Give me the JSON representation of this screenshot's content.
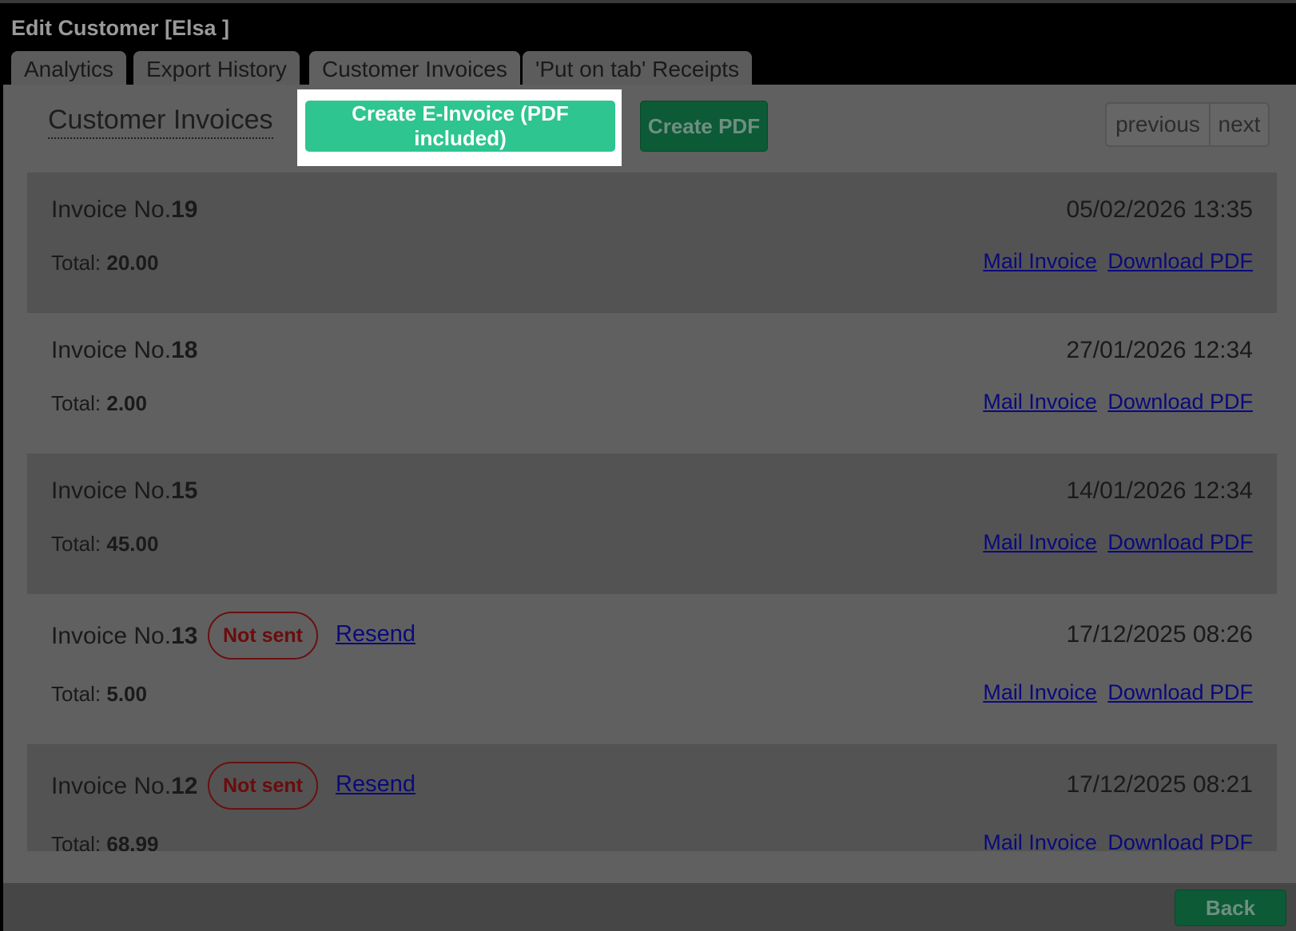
{
  "window": {
    "title": "Edit Customer [Elsa ]"
  },
  "tabs": [
    {
      "label": "Analytics"
    },
    {
      "label": "Export History"
    },
    {
      "label": "Customer Invoices"
    },
    {
      "label": "'Put on tab' Receipts"
    }
  ],
  "toolbar": {
    "section_title": "Customer Invoices",
    "create_einvoice_label": "Create E-Invoice (PDF included)",
    "create_pdf_label": "Create PDF"
  },
  "pager": {
    "previous_label": "previous",
    "next_label": "next"
  },
  "invoice_labels": {
    "invoice_prefix": "Invoice No.",
    "total_prefix": "Total: ",
    "mail_label": "Mail Invoice",
    "download_label": "Download PDF",
    "not_sent_label": "Not sent",
    "resend_label": "Resend"
  },
  "invoices": [
    {
      "number": "19",
      "date": "05/02/2026 13:35",
      "total": "20.00"
    },
    {
      "number": "18",
      "date": "27/01/2026 12:34",
      "total": "2.00"
    },
    {
      "number": "15",
      "date": "14/01/2026 12:34",
      "total": "45.00"
    },
    {
      "number": "13",
      "date": "17/12/2025 08:26",
      "total": "5.00"
    },
    {
      "number": "12",
      "date": "17/12/2025 08:21",
      "total": "68.99"
    }
  ],
  "footer": {
    "back_label": "Back"
  },
  "colors": {
    "accent_green": "#2ec590",
    "dark_green": "#0c5a36",
    "link": "#0a0a7a",
    "not_sent": "#6a0c0c"
  }
}
